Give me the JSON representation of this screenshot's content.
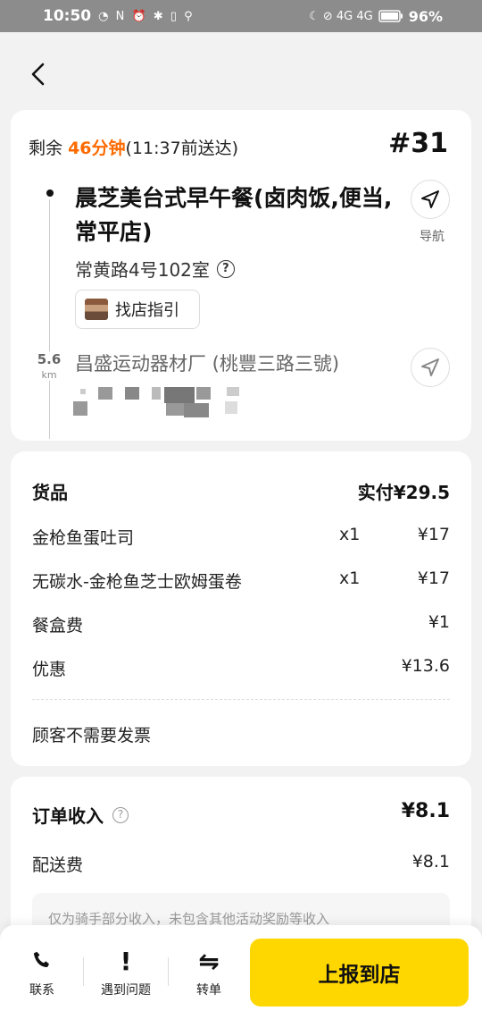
{
  "status_bar": {
    "time": "10:50",
    "left_icons": "◔ N ⏰ ✱ ▯ ⚲",
    "right_icons": "☾ ⊘ 4G 4G",
    "battery": "96%"
  },
  "header": {
    "back_icon": "chevron-left-icon"
  },
  "delivery": {
    "remain_prefix": "剩余",
    "remain_time": "46分钟",
    "deadline": "(11:37前送达)",
    "order_number": "#31",
    "shop_name": "晨芝美台式早午餐(卤肉饭,便当,常平店)",
    "shop_address": "常黄路4号102室",
    "help_icon": "?",
    "guide_button": "找店指引",
    "nav_label": "导航",
    "distance_value": "5.6",
    "distance_unit": "km",
    "destination": "昌盛运动器材厂 (桃豐三路三號)"
  },
  "goods": {
    "title": "货品",
    "paid": "实付¥29.5",
    "items": [
      {
        "name": "金枪鱼蛋吐司",
        "qty": "x1",
        "price": "¥17"
      },
      {
        "name": "无碳水-金枪鱼芝士欧姆蛋卷",
        "qty": "x1",
        "price": "¥17"
      }
    ],
    "box_fee_label": "餐盒费",
    "box_fee": "¥1",
    "discount_label": "优惠",
    "discount": "¥13.6",
    "invoice_note": "顾客不需要发票"
  },
  "income": {
    "title": "订单收入",
    "help_icon": "?",
    "total": "¥8.1",
    "delivery_fee_label": "配送费",
    "delivery_fee": "¥8.1",
    "note": "仅为骑手部分收入，未包含其他活动奖励等收入"
  },
  "bottom_bar": {
    "contact": "联系",
    "problem": "遇到问题",
    "problem_icon": "!",
    "transfer": "转单",
    "transfer_icon": "⇋",
    "report": "上报到店"
  },
  "colors": {
    "accent_orange": "#ff6a00",
    "button_yellow": "#ffd700"
  }
}
